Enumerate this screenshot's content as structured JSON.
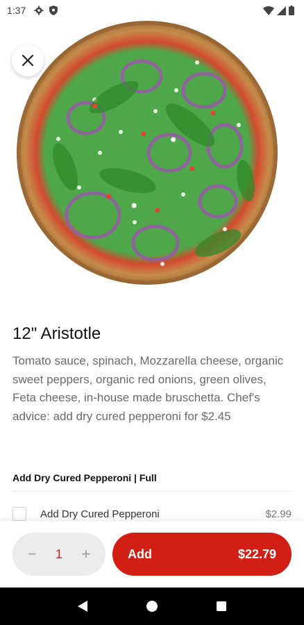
{
  "status_bar": {
    "time": "1:37",
    "icons": [
      "gear-icon",
      "shield-icon",
      "wifi-icon",
      "cellular-icon",
      "battery-icon"
    ]
  },
  "hero": {
    "image": "pizza-photo",
    "close_icon": "close-icon"
  },
  "item": {
    "title": "12\" Aristotle",
    "description": "Tomato sauce, spinach, Mozzarella cheese, organic sweet peppers, organic red onions, green olives, Feta cheese, in-house made bruschetta. Chef's advice: add dry cured pepperoni for $2.45"
  },
  "options": {
    "section_title": "Add Dry Cured Pepperoni | Full",
    "items": [
      {
        "label": "Add Dry Cured Pepperoni",
        "price": "$2.99",
        "checked": false
      }
    ]
  },
  "cart": {
    "minus": "−",
    "quantity": "1",
    "plus": "+",
    "add_label": "Add",
    "total": "$22.79"
  },
  "nav": {
    "icons": [
      "back-icon",
      "home-icon",
      "recents-icon"
    ]
  },
  "colors": {
    "accent": "#d11f16",
    "stepper_bg": "#ececec",
    "nav_bg": "#000000"
  }
}
